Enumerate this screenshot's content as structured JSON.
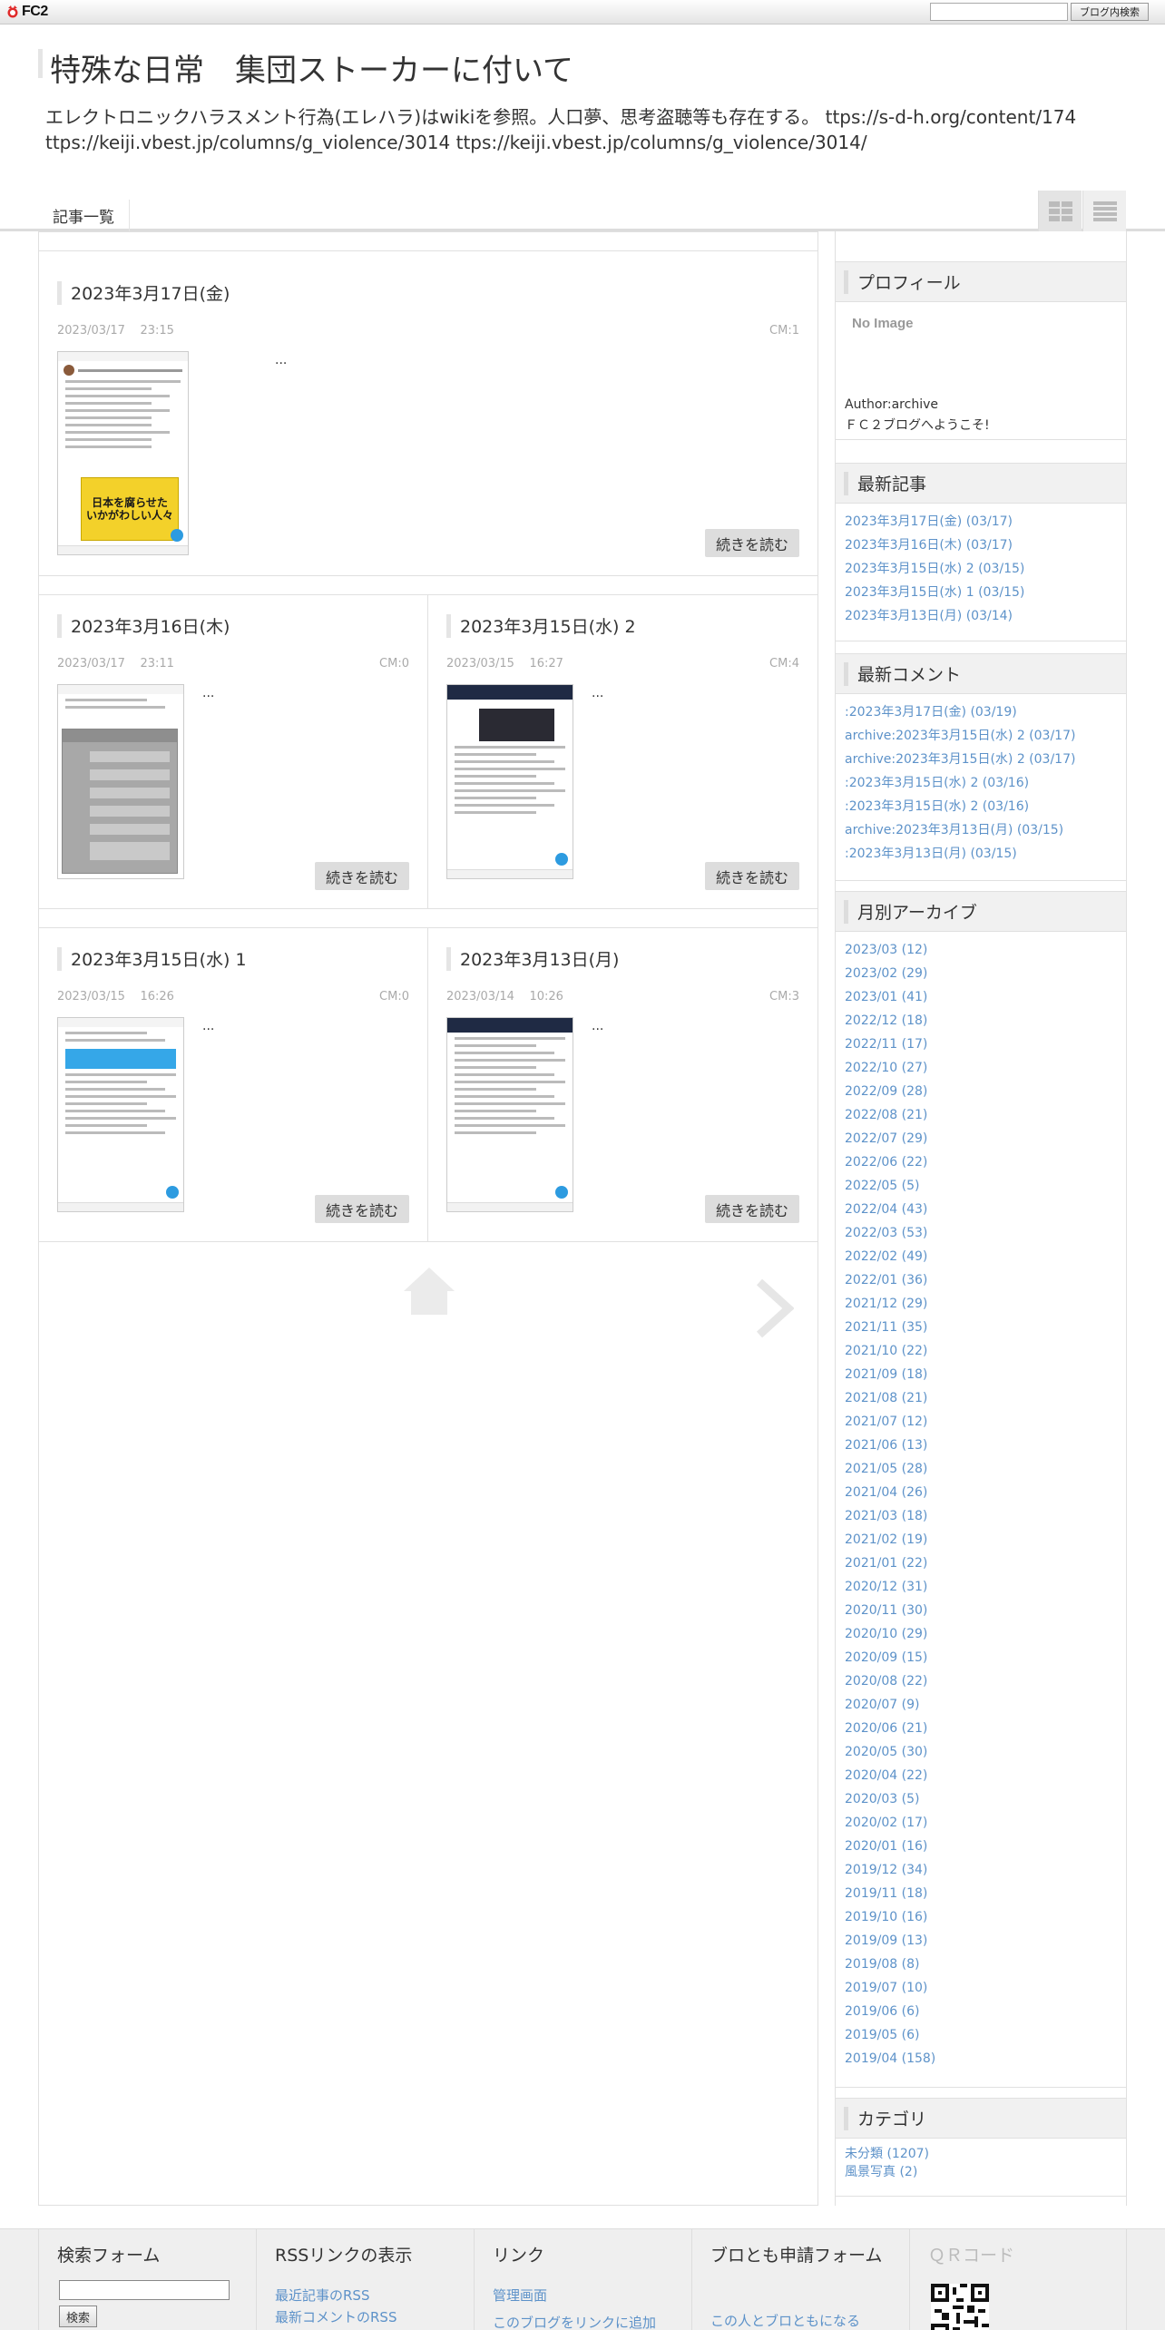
{
  "fc2bar": {
    "logo_text": "FC2",
    "search_placeholder": "",
    "search_button": "ブログ内検索"
  },
  "header": {
    "title": "特殊な日常　集団ストーカーに付いて",
    "description": "エレクトロニックハラスメント行為(エレハラ)はwikiを参照。人口夢、思考盗聴等も存在する。 ttps://s-d-h.org/content/174 ttps://keiji.vbest.jp/columns/g_violence/3014 ttps://keiji.vbest.jp/columns/g_violence/3014/"
  },
  "nav": {
    "list_link": "記事一覧"
  },
  "articles": [
    {
      "title": "2023年3月17日(金)",
      "date": "2023/03/17",
      "time": "23:15",
      "comments": "CM:1",
      "excerpt": "...",
      "more": "続きを読む"
    },
    {
      "title": "2023年3月16日(木)",
      "date": "2023/03/17",
      "time": "23:11",
      "comments": "CM:0",
      "excerpt": "...",
      "more": "続きを読む"
    },
    {
      "title": "2023年3月15日(水) 2",
      "date": "2023/03/15",
      "time": "16:27",
      "comments": "CM:4",
      "excerpt": "...",
      "more": "続きを読む"
    },
    {
      "title": "2023年3月15日(水) 1",
      "date": "2023/03/15",
      "time": "16:26",
      "comments": "CM:0",
      "excerpt": "...",
      "more": "続きを読む"
    },
    {
      "title": "2023年3月13日(月)",
      "date": "2023/03/14",
      "time": "10:26",
      "comments": "CM:3",
      "excerpt": "...",
      "more": "続きを読む"
    }
  ],
  "thumb_text": {
    "book_title": "日本を腐らせた\nいかがわしい人々"
  },
  "sidebar": {
    "profile": {
      "title": "プロフィール",
      "no_image": "No Image",
      "author": "Author:archive",
      "welcome": "ＦＣ２ブログへようこそ!"
    },
    "recent_posts": {
      "title": "最新記事",
      "items": [
        "2023年3月17日(金) (03/17)",
        "2023年3月16日(木) (03/17)",
        "2023年3月15日(水) 2 (03/15)",
        "2023年3月15日(水) 1 (03/15)",
        "2023年3月13日(月) (03/14)"
      ]
    },
    "recent_comments": {
      "title": "最新コメント",
      "items": [
        ":2023年3月17日(金) (03/19)",
        "archive:2023年3月15日(水) 2 (03/17)",
        "archive:2023年3月15日(水) 2 (03/17)",
        ":2023年3月15日(水) 2 (03/16)",
        ":2023年3月15日(水) 2 (03/16)",
        "archive:2023年3月13日(月) (03/15)",
        ":2023年3月13日(月) (03/15)"
      ]
    },
    "archives": {
      "title": "月別アーカイブ",
      "items": [
        "2023/03 (12)",
        "2023/02 (29)",
        "2023/01 (41)",
        "2022/12 (18)",
        "2022/11 (17)",
        "2022/10 (27)",
        "2022/09 (28)",
        "2022/08 (21)",
        "2022/07 (29)",
        "2022/06 (22)",
        "2022/05 (5)",
        "2022/04 (43)",
        "2022/03 (53)",
        "2022/02 (49)",
        "2022/01 (36)",
        "2021/12 (29)",
        "2021/11 (35)",
        "2021/10 (22)",
        "2021/09 (18)",
        "2021/08 (21)",
        "2021/07 (12)",
        "2021/06 (13)",
        "2021/05 (28)",
        "2021/04 (26)",
        "2021/03 (18)",
        "2021/02 (19)",
        "2021/01 (22)",
        "2020/12 (31)",
        "2020/11 (30)",
        "2020/10 (29)",
        "2020/09 (15)",
        "2020/08 (22)",
        "2020/07 (9)",
        "2020/06 (21)",
        "2020/05 (30)",
        "2020/04 (22)",
        "2020/03 (5)",
        "2020/02 (17)",
        "2020/01 (16)",
        "2019/12 (34)",
        "2019/11 (18)",
        "2019/10 (16)",
        "2019/09 (13)",
        "2019/08 (8)",
        "2019/07 (10)",
        "2019/06 (6)",
        "2019/05 (6)",
        "2019/04 (158)"
      ]
    },
    "categories": {
      "title": "カテゴリ",
      "items": [
        "未分類 (1207)",
        "風景写真 (2)"
      ]
    }
  },
  "footer": {
    "search": {
      "title": "検索フォーム",
      "button": "検索"
    },
    "rss": {
      "title": "RSSリンクの表示",
      "links": [
        "最近記事のRSS",
        "最新コメントのRSS"
      ]
    },
    "links": {
      "title": "リンク",
      "links": [
        "管理画面",
        "このブログをリンクに追加"
      ]
    },
    "friends": {
      "title": "ブロとも申請フォーム",
      "links": [
        "この人とブロともになる"
      ]
    },
    "qr": {
      "title": "ＱＲコード"
    }
  }
}
